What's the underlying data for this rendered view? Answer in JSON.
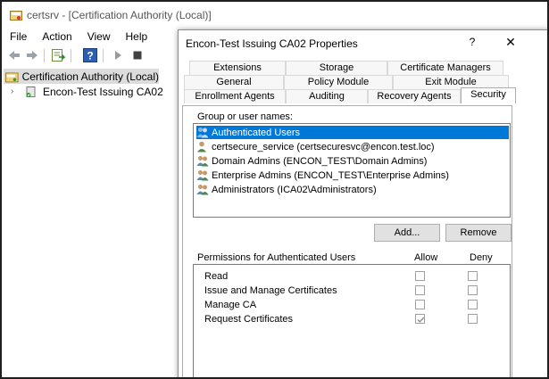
{
  "window": {
    "title": "certsrv - [Certification Authority (Local)]"
  },
  "menu": [
    "File",
    "Action",
    "View",
    "Help"
  ],
  "toolbar": {
    "icons": [
      "back-arrow-icon",
      "forward-arrow-icon",
      "export-list-icon",
      "help-icon",
      "play-icon",
      "stop-icon"
    ]
  },
  "tree": {
    "items": [
      {
        "label": "Certification Authority (Local)",
        "selected": true
      },
      {
        "label": "Encon-Test Issuing CA02",
        "selected": false
      }
    ]
  },
  "dialog": {
    "title": "Encon-Test Issuing CA02 Properties",
    "help_glyph": "?",
    "close_glyph": "✕",
    "tabs": {
      "row1": [
        "Extensions",
        "Storage",
        "Certificate Managers"
      ],
      "row2": [
        "General",
        "Policy Module",
        "Exit Module"
      ],
      "row3": [
        "Enrollment Agents",
        "Auditing",
        "Recovery Agents",
        "Security"
      ]
    },
    "active_tab": "Security",
    "group_label": "Group or user names:",
    "users": [
      {
        "name": "Authenticated Users",
        "type": "group",
        "selected": true
      },
      {
        "name": "certsecure_service (certsecuresvc@encon.test.loc)",
        "type": "user",
        "selected": false
      },
      {
        "name": "Domain Admins (ENCON_TEST\\Domain Admins)",
        "type": "group",
        "selected": false
      },
      {
        "name": "Enterprise Admins (ENCON_TEST\\Enterprise Admins)",
        "type": "group",
        "selected": false
      },
      {
        "name": "Administrators (ICA02\\Administrators)",
        "type": "group",
        "selected": false
      }
    ],
    "add_button": "Add...",
    "remove_button": "Remove",
    "permissions_label": "Permissions for Authenticated Users",
    "allow_header": "Allow",
    "deny_header": "Deny",
    "permissions": [
      {
        "name": "Read",
        "allow": false,
        "deny": false
      },
      {
        "name": "Issue and Manage Certificates",
        "allow": false,
        "deny": false
      },
      {
        "name": "Manage CA",
        "allow": false,
        "deny": false
      },
      {
        "name": "Request Certificates",
        "allow": true,
        "deny": false
      }
    ]
  },
  "colors": {
    "selection": "#0078d7",
    "tree_selection": "#dcdcdc",
    "border": "#adadad"
  }
}
